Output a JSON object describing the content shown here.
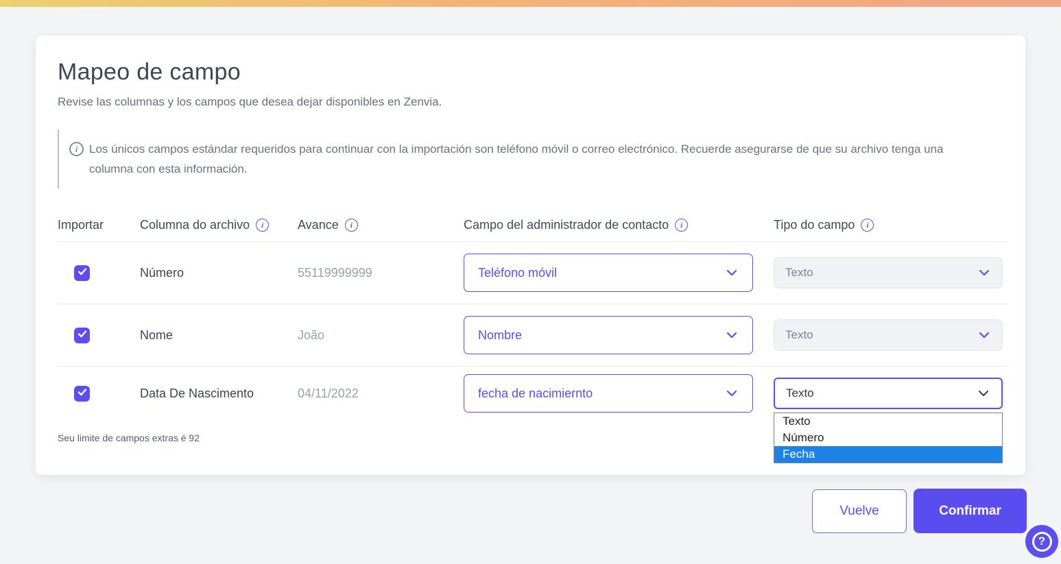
{
  "card": {
    "title": "Mapeo de campo",
    "subtitle": "Revise las columnas y los campos que desea dejar disponibles en Zenvia.",
    "info_note": "Los únicos campos estándar requeridos para continuar con la importación son teléfono móvil o correo electrónico. Recuerde asegurarse de que su archivo tenga una columna con esta información.",
    "footnote": "Seu limite de campos extras é 92"
  },
  "table": {
    "headers": [
      {
        "label": "Importar",
        "has_info": false
      },
      {
        "label": "Columna do archivo",
        "has_info": true
      },
      {
        "label": "Avance",
        "has_info": true
      },
      {
        "label": "Campo del administrador de contacto",
        "has_info": true
      },
      {
        "label": "Tipo do campo",
        "has_info": true
      }
    ],
    "rows": [
      {
        "checked": true,
        "column": "Número",
        "preview": "55119999999",
        "field": "Teléfono móvil",
        "type": "Texto"
      },
      {
        "checked": true,
        "column": "Nome",
        "preview": "João",
        "field": "Nombre",
        "type": "Texto"
      },
      {
        "checked": true,
        "column": "Data De Nascimento",
        "preview": "04/11/2022",
        "field": "fecha de nacimiernto",
        "type": "Texto",
        "dropdown_open": true
      }
    ],
    "type_options": [
      "Texto",
      "Número",
      "Fecha"
    ],
    "highlighted_option": "Fecha"
  },
  "actions": {
    "back_label": "Vuelve",
    "confirm_label": "Confirmar"
  },
  "help": {
    "glyph": "?"
  },
  "icons": {
    "info_glyph": "i"
  },
  "colors": {
    "accent_purple": "#5b4df1",
    "confirm_button": "#5a4df0",
    "dropdown_highlight": "#1c82e8",
    "topbar_gradient_start": "#edd06f",
    "topbar_gradient_end": "#f2a487",
    "page_background": "#f3f4f6",
    "muted_text": "#9aa0ae",
    "dark_text": "#3f4254"
  }
}
